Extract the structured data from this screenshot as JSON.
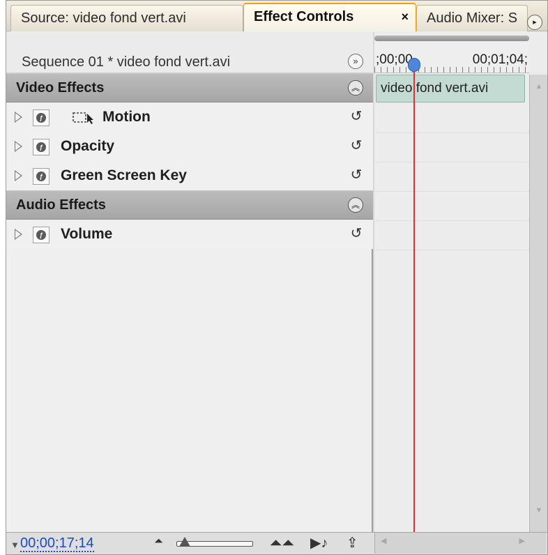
{
  "tabs": {
    "source": "Source: video fond vert.avi",
    "effect_controls": "Effect Controls",
    "effect_controls_close": "×",
    "audio_mixer": "Audio Mixer: S",
    "panel_menu": "▸"
  },
  "header": {
    "sequence_label": "Sequence 01 * video fond vert.avi",
    "timeline_toggle": "»"
  },
  "sections": {
    "video": {
      "title": "Video Effects",
      "collapse": "︽"
    },
    "audio": {
      "title": "Audio Effects",
      "collapse": "︽"
    }
  },
  "effects": {
    "motion": {
      "name": "Motion",
      "reset": "↺"
    },
    "opacity": {
      "name": "Opacity",
      "reset": "↺"
    },
    "green_screen": {
      "name": "Green Screen Key",
      "reset": "↺"
    },
    "volume": {
      "name": "Volume",
      "reset": "↺"
    }
  },
  "timeline": {
    "start_tc": ";00;00",
    "end_tc": "00;01;04;",
    "clip_name": "video fond vert.avi"
  },
  "footer": {
    "current_time": "00;00;17;14",
    "zoom_out": "⏶",
    "zoom_in": "⏶⏶",
    "play_audio": "▶♪",
    "export": "⇪"
  },
  "colors": {
    "tab_active_accent": "#f0a010",
    "clip_fill": "#c4dbd4",
    "playhead": "#e03030",
    "timecode_link": "#1b4bbf"
  },
  "icons": {
    "motion": "transform-icon",
    "fx": "fx-badge-icon",
    "reset": "reset-icon"
  }
}
